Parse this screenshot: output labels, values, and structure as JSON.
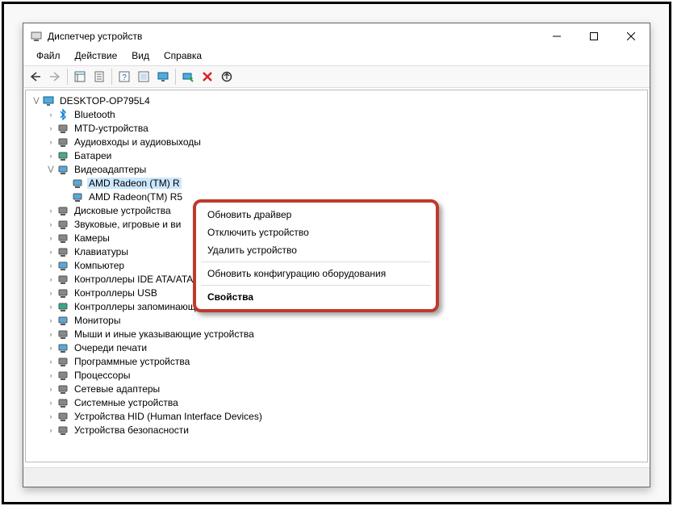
{
  "title": "Диспетчер устройств",
  "menubar": [
    "Файл",
    "Действие",
    "Вид",
    "Справка"
  ],
  "root_node": "DESKTOP-OP795L4",
  "categories": [
    {
      "id": "bluetooth",
      "label": "Bluetooth",
      "expanded": false
    },
    {
      "id": "mtd",
      "label": "MTD-устройства",
      "expanded": false
    },
    {
      "id": "audio",
      "label": "Аудиовходы и аудиовыходы",
      "expanded": false
    },
    {
      "id": "battery",
      "label": "Батареи",
      "expanded": false
    },
    {
      "id": "video",
      "label": "Видеоадаптеры",
      "expanded": true,
      "children": [
        {
          "id": "gpu0",
          "label": "AMD Radeon (TM) R",
          "selected": true,
          "truncated": true
        },
        {
          "id": "gpu1",
          "label": "AMD Radeon(TM) R5"
        }
      ]
    },
    {
      "id": "disk",
      "label": "Дисковые устройства",
      "expanded": false
    },
    {
      "id": "sound",
      "label": "Звуковые, игровые и ви",
      "expanded": false,
      "truncated": true
    },
    {
      "id": "camera",
      "label": "Камеры",
      "expanded": false
    },
    {
      "id": "keyboard",
      "label": "Клавиатуры",
      "expanded": false
    },
    {
      "id": "computer",
      "label": "Компьютер",
      "expanded": false
    },
    {
      "id": "ide",
      "label": "Контроллеры IDE ATA/ATAPI",
      "expanded": false
    },
    {
      "id": "usb",
      "label": "Контроллеры USB",
      "expanded": false
    },
    {
      "id": "storage",
      "label": "Контроллеры запоминающих устройств",
      "expanded": false
    },
    {
      "id": "monitor",
      "label": "Мониторы",
      "expanded": false
    },
    {
      "id": "mouse",
      "label": "Мыши и иные указывающие устройства",
      "expanded": false
    },
    {
      "id": "printq",
      "label": "Очереди печати",
      "expanded": false
    },
    {
      "id": "software",
      "label": "Программные устройства",
      "expanded": false
    },
    {
      "id": "cpu",
      "label": "Процессоры",
      "expanded": false
    },
    {
      "id": "network",
      "label": "Сетевые адаптеры",
      "expanded": false
    },
    {
      "id": "system",
      "label": "Системные устройства",
      "expanded": false
    },
    {
      "id": "hid",
      "label": "Устройства HID (Human Interface Devices)",
      "expanded": false
    },
    {
      "id": "security",
      "label": "Устройства безопасности",
      "expanded": false
    }
  ],
  "context_menu": {
    "items": [
      {
        "id": "update",
        "label": "Обновить драйвер"
      },
      {
        "id": "disable",
        "label": "Отключить устройство"
      },
      {
        "id": "uninstall",
        "label": "Удалить устройство"
      },
      {
        "sep": true
      },
      {
        "id": "scan",
        "label": "Обновить конфигурацию оборудования"
      },
      {
        "sep": true
      },
      {
        "id": "props",
        "label": "Свойства",
        "bold": true
      }
    ]
  },
  "toolbar_buttons": [
    {
      "id": "back",
      "name": "back-icon"
    },
    {
      "id": "fwd",
      "name": "forward-icon"
    },
    {
      "sep": true
    },
    {
      "id": "showtree",
      "name": "show-tree-icon"
    },
    {
      "id": "prop",
      "name": "properties-icon"
    },
    {
      "sep": true
    },
    {
      "id": "help",
      "name": "help-icon"
    },
    {
      "id": "show",
      "name": "show-hidden-icon"
    },
    {
      "id": "screen",
      "name": "screen-icon"
    },
    {
      "sep": true
    },
    {
      "id": "scan",
      "name": "scan-icon"
    },
    {
      "id": "delete",
      "name": "delete-icon"
    },
    {
      "id": "off",
      "name": "disable-icon"
    }
  ],
  "icons": {
    "bluetooth": "#0078d4",
    "mtd": "#888",
    "audio": "#888",
    "battery": "#4a8",
    "video": "#5ad",
    "disk": "#888",
    "sound": "#888",
    "camera": "#888",
    "keyboard": "#888",
    "computer": "#5ad",
    "ide": "#888",
    "usb": "#888",
    "storage": "#3a8",
    "monitor": "#5ad",
    "mouse": "#888",
    "printq": "#5ad",
    "software": "#888",
    "cpu": "#888",
    "network": "#888",
    "system": "#888",
    "hid": "#888",
    "security": "#888",
    "gpu0": "#5ad",
    "gpu1": "#5ad",
    "root": "#5ad"
  }
}
